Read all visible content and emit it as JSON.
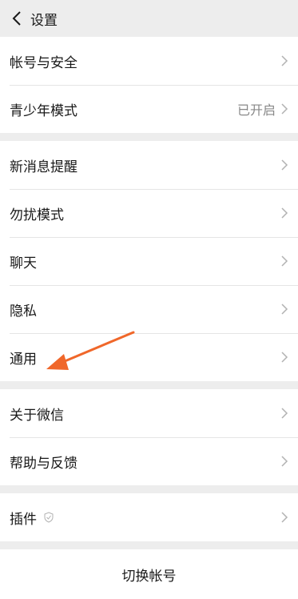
{
  "header": {
    "title": "设置"
  },
  "groups": [
    {
      "items": [
        {
          "label": "帐号与安全",
          "value": ""
        },
        {
          "label": "青少年模式",
          "value": "已开启"
        }
      ]
    },
    {
      "items": [
        {
          "label": "新消息提醒"
        },
        {
          "label": "勿扰模式"
        },
        {
          "label": "聊天"
        },
        {
          "label": "隐私"
        },
        {
          "label": "通用"
        }
      ]
    },
    {
      "items": [
        {
          "label": "关于微信"
        },
        {
          "label": "帮助与反馈"
        }
      ]
    },
    {
      "items": [
        {
          "label": "插件"
        }
      ]
    }
  ],
  "footer": {
    "switch_account": "切换帐号"
  },
  "colors": {
    "arrow": "#f0672a",
    "background": "#ededed",
    "chevron": "#b2b2b2"
  }
}
